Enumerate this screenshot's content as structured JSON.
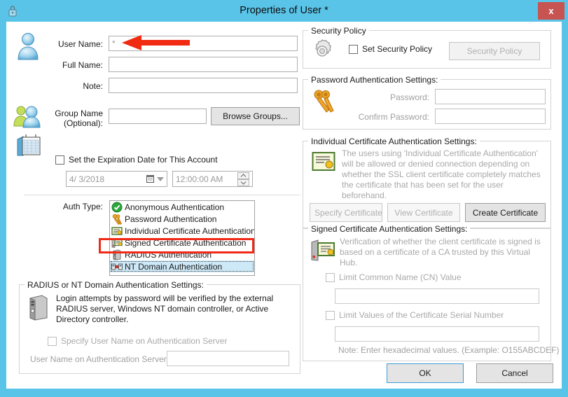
{
  "window": {
    "title": "Properties of User *",
    "close_label": "x",
    "titlebar_color": "#5ac4e8",
    "close_color": "#c75450",
    "accent_color": "#3f9bd4",
    "annotation_color": "#ef2a18"
  },
  "left": {
    "user_name_label": "User Name:",
    "user_name_value": "*",
    "full_name_label": "Full Name:",
    "full_name_value": "",
    "note_label": "Note:",
    "note_value": "",
    "group_name_label_line1": "Group Name",
    "group_name_label_line2": "(Optional):",
    "group_name_value": "",
    "browse_groups_label": "Browse Groups...",
    "expiration_checkbox_label": "Set the Expiration Date for This Account",
    "expiration_date_value": "4/ 3/2018",
    "expiration_time_value": "12:00:00 AM",
    "auth_type_label": "Auth Type:",
    "auth_items": [
      {
        "label": "Anonymous Authentication",
        "icon": "green-check-icon",
        "selected": false
      },
      {
        "label": "Password Authentication",
        "icon": "keys-icon",
        "selected": false
      },
      {
        "label": "Individual Certificate Authentication",
        "icon": "certificate-icon",
        "selected": false
      },
      {
        "label": "Signed Certificate Authentication",
        "icon": "signed-certificate-icon",
        "selected": false
      },
      {
        "label": "RADIUS Authentication",
        "icon": "server-icon",
        "selected": false
      },
      {
        "label": "NT Domain Authentication",
        "icon": "nt-domain-icon",
        "selected": true
      }
    ]
  },
  "radius_group": {
    "title": "RADIUS or NT Domain Authentication Settings:",
    "description": "Login attempts by password will be verified by the external RADIUS server, Windows NT domain controller, or Active Directory controller.",
    "specify_user_checkbox_label": "Specify User Name on Authentication Server",
    "user_name_server_label": "User Name on Authentication Server:",
    "user_name_server_value": ""
  },
  "security_policy_group": {
    "title": "Security Policy",
    "checkbox_label": "Set Security Policy",
    "button_label": "Security Policy"
  },
  "password_group": {
    "title": "Password Authentication Settings:",
    "password_label": "Password:",
    "password_value": "",
    "confirm_label": "Confirm Password:",
    "confirm_value": ""
  },
  "individual_cert_group": {
    "title": "Individual Certificate Authentication Settings:",
    "description": "The users using 'Individual Certificate Authentication' will be allowed or denied connection depending on whether the SSL client certificate completely matches the certificate that has been set for the user beforehand.",
    "specify_certificate_label": "Specify Certificate",
    "view_certificate_label": "View Certificate",
    "create_certificate_label": "Create Certificate"
  },
  "signed_cert_group": {
    "title": "Signed Certificate Authentication Settings:",
    "description": "Verification of whether the client certificate is signed is based on a certificate of a CA trusted by this Virtual Hub.",
    "limit_cn_label": "Limit Common Name (CN) Value",
    "limit_cn_value": "",
    "limit_serial_label": "Limit Values of the Certificate Serial Number",
    "limit_serial_value": "",
    "note": "Note: Enter hexadecimal values. (Example: O155ABCDEF)"
  },
  "footer": {
    "ok_label": "OK",
    "cancel_label": "Cancel"
  }
}
